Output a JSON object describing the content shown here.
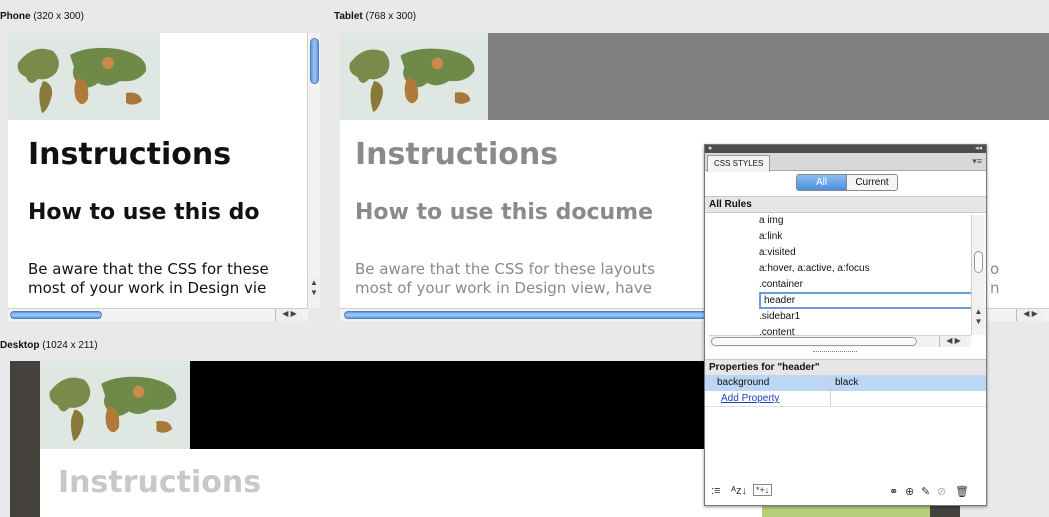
{
  "labels": {
    "phone_name": "Phone",
    "phone_size": "(320 x 300)",
    "tablet_name": "Tablet",
    "tablet_size": "(768 x 300)",
    "desktop_name": "Desktop",
    "desktop_size": "(1024 x 211)"
  },
  "content": {
    "heading": "Instructions",
    "subheading_phone": "How to use this do",
    "subheading_tablet": "How to use this docume",
    "para1_phone": "Be aware that the CSS for these",
    "para2_phone": "most of your work in Design vie",
    "para1_tablet": "Be aware that the CSS for these layouts",
    "para2_tablet": "most of your work in Design view, have",
    "tablet_tail1": "o",
    "tablet_tail2": "n"
  },
  "css_panel": {
    "tab": "CSS STYLES",
    "toggle_all": "All",
    "toggle_current": "Current",
    "all_rules_header": "All Rules",
    "rules": [
      "a img",
      "a:link",
      "a:visited",
      "a:hover, a:active, a:focus",
      ".container",
      "header",
      ".sidebar1",
      ".content"
    ],
    "selected_rule": "header",
    "properties_header": "Properties for \"header\"",
    "property_name": "background",
    "property_value": "black",
    "add_property": "Add Property"
  },
  "colors": {
    "accent": "#4b8fe0",
    "tablet_header_bg": "#808080",
    "desktop_header_bg": "#000000",
    "desktop_sidebar": "#45423d"
  }
}
